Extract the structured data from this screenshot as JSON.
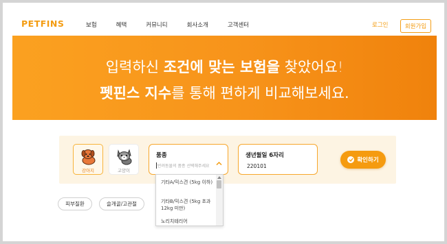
{
  "header": {
    "logo": "PETFINS",
    "nav": [
      "보험",
      "혜택",
      "커뮤니티",
      "회사소개",
      "고객센터"
    ],
    "login": "로그인",
    "signup": "회원가입"
  },
  "hero": {
    "line1_pre": "입력하신 ",
    "line1_bold": "조건에 맞는 보험을",
    "line1_post": " 찾았어요!",
    "line2_bold": "펫핀스 지수",
    "line2_post": "를 통해 편하게 비교해보세요."
  },
  "form": {
    "pets": [
      {
        "label": "강아지",
        "icon": "dog-icon",
        "selected": true
      },
      {
        "label": "고양이",
        "icon": "cat-icon",
        "selected": false
      }
    ],
    "breed": {
      "label": "품종",
      "placeholder": "반려동물의 품종 선택해주세요"
    },
    "birth": {
      "label": "생년월일 6자리",
      "value": "220101"
    },
    "confirm": "확인하기"
  },
  "tags": [
    "피부질환",
    "슬개골/고관절"
  ],
  "dropdown": {
    "options": [
      "기타A/믹스견 (5kg 이하)",
      "기타B/믹스견 (5kg 초과 12kg 미만)",
      "노리치테리어"
    ]
  },
  "colors": {
    "accent": "#f39c12",
    "hero_start": "#fba120",
    "hero_end": "#f0820c",
    "panel_bg": "#fdf4e3"
  }
}
